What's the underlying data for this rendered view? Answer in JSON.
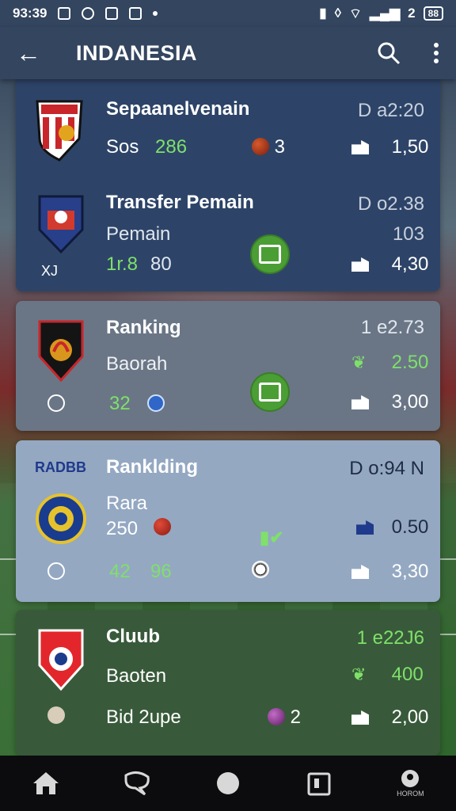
{
  "status_bar": {
    "time": "93:39",
    "signal_text": "2",
    "battery": "88"
  },
  "app_bar": {
    "title": "INDANESIA"
  },
  "cards": [
    {
      "name": "Sepaanelvenain",
      "date": "D a2:20",
      "line2_label": "Sos",
      "line2_value": "286",
      "count": "3",
      "value": "1,50"
    },
    {
      "name": "Transfer Pemain",
      "date": "D o2.38",
      "line2_label": "Pemain",
      "line2_right": "103",
      "line3_a": "1r.8",
      "line3_b": "80",
      "crest_text": "XJ",
      "value": "4,30"
    },
    {
      "name": "Ranking",
      "date": "1 e2.73",
      "line2_label": "Baorah",
      "line2_right": "2.50",
      "line3_a": "32",
      "value": "3,00"
    },
    {
      "name": "Ranklding",
      "brand": "RADBB",
      "date": "D o:94 N",
      "line2_label": "Rara",
      "line2_value": "250",
      "line2_right": "0.50",
      "line3_a": "42",
      "line3_b": "96",
      "value": "3,30"
    },
    {
      "name": "Cluub",
      "date": "1 e22J6",
      "line2_label": "Baoten",
      "line2_right": "400",
      "line3_a": "Bid 2upe",
      "count": "2",
      "value": "2,00"
    }
  ],
  "nav": {
    "last_label": "HOROM"
  },
  "colors": {
    "header": "#33455f",
    "card_dark": "#2d4468",
    "card_gray": "#6a7686",
    "card_light": "#94a8c2",
    "card_green": "#385a3a",
    "accent_green": "#7fe06a"
  }
}
